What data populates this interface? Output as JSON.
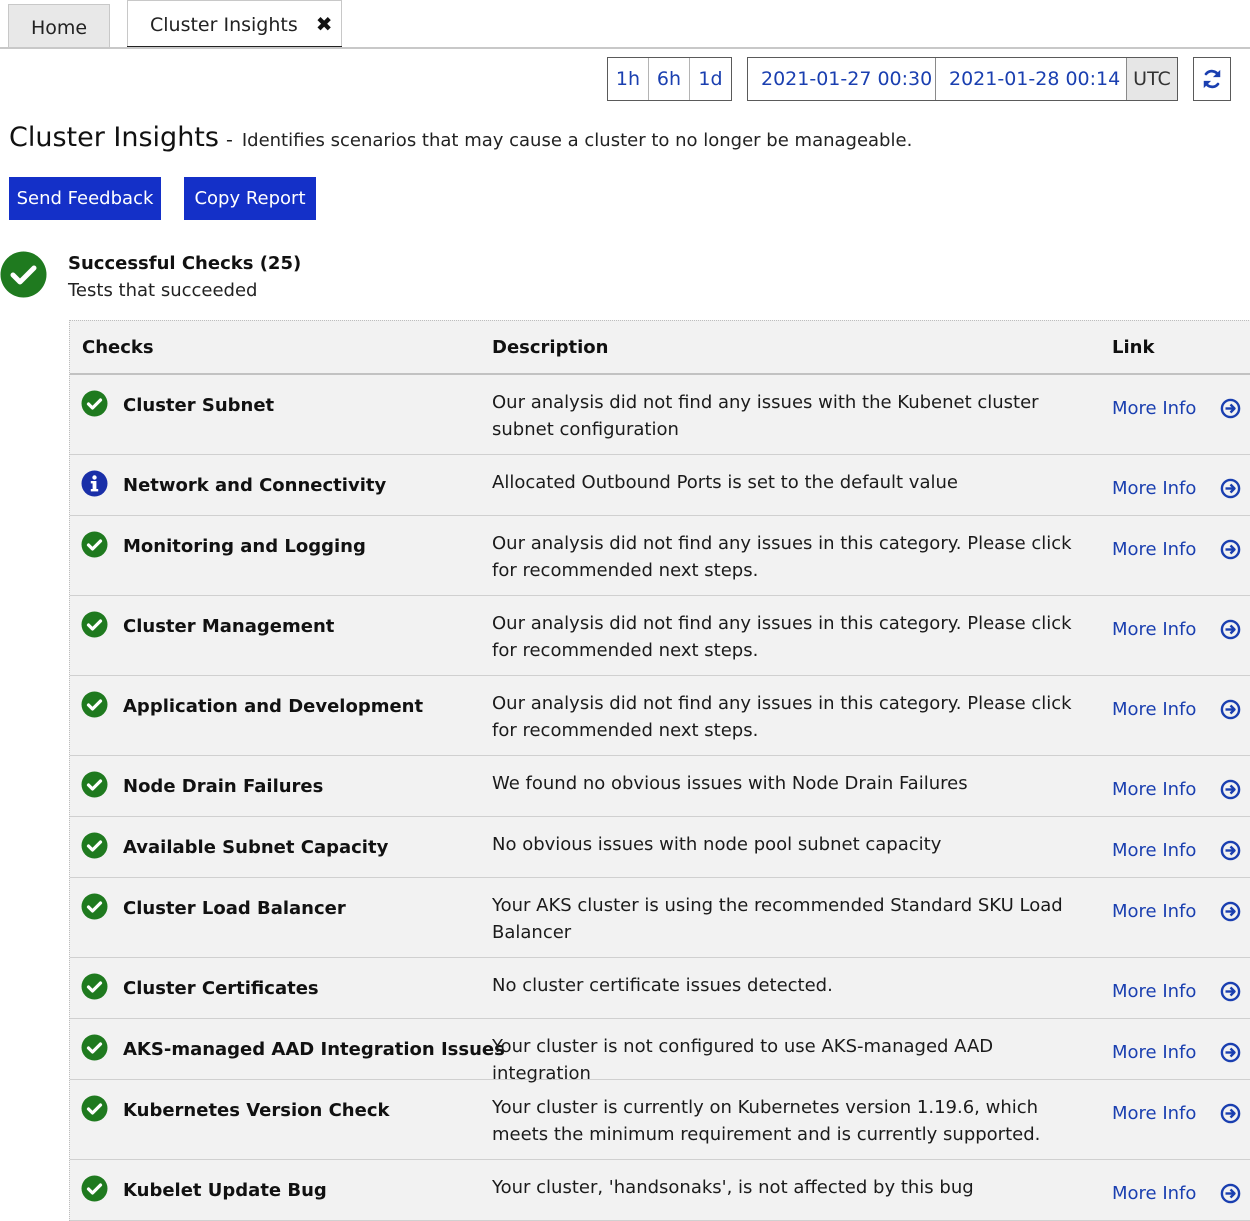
{
  "tabs": {
    "home_label": "Home",
    "active_label": "Cluster Insights",
    "close_glyph": "✖"
  },
  "time_controls": {
    "presets": [
      "1h",
      "6h",
      "1d"
    ],
    "range_start": "2021-01-27 00:30",
    "range_end": "2021-01-28 00:14",
    "timezone": "UTC"
  },
  "header": {
    "title": "Cluster Insights",
    "separator": "-",
    "subtitle": "Identifies scenarios that may cause a cluster to no longer be manageable."
  },
  "actions": {
    "send_feedback": "Send Feedback",
    "copy_report": "Copy Report"
  },
  "summary": {
    "title": "Successful Checks (25)",
    "subtitle": "Tests that succeeded"
  },
  "table": {
    "columns": [
      "Checks",
      "Description",
      "Link"
    ],
    "rows": [
      {
        "status": "success",
        "name": "Cluster Subnet",
        "description": "Our analysis did not find any issues with the Kubenet cluster subnet configuration",
        "link": "More Info"
      },
      {
        "status": "info",
        "name": "Network and Connectivity",
        "description": "Allocated Outbound Ports is set to the default value",
        "link": "More Info"
      },
      {
        "status": "success",
        "name": "Monitoring and Logging",
        "description": "Our analysis did not find any issues in this category. Please click for recommended next steps.",
        "link": "More Info"
      },
      {
        "status": "success",
        "name": "Cluster Management",
        "description": "Our analysis did not find any issues in this category. Please click for recommended next steps.",
        "link": "More Info"
      },
      {
        "status": "success",
        "name": "Application and Development",
        "description": "Our analysis did not find any issues in this category. Please click for recommended next steps.",
        "link": "More Info"
      },
      {
        "status": "success",
        "name": "Node Drain Failures",
        "description": "We found no obvious issues with Node Drain Failures",
        "link": "More Info"
      },
      {
        "status": "success",
        "name": "Available Subnet Capacity",
        "description": "No obvious issues with node pool subnet capacity",
        "link": "More Info"
      },
      {
        "status": "success",
        "name": "Cluster Load Balancer",
        "description": "Your AKS cluster is using the recommended Standard SKU Load Balancer",
        "link": "More Info"
      },
      {
        "status": "success",
        "name": "Cluster Certificates",
        "description": "No cluster certificate issues detected.",
        "link": "More Info"
      },
      {
        "status": "success",
        "name": "AKS-managed AAD Integration Issues",
        "description": "Your cluster is not configured to use AKS-managed AAD integration",
        "link": "More Info"
      },
      {
        "status": "success",
        "name": "Kubernetes Version Check",
        "description": "Your cluster is currently on Kubernetes version 1.19.6, which meets the minimum requirement and is currently supported.",
        "link": "More Info"
      },
      {
        "status": "success",
        "name": "Kubelet Update Bug",
        "description": "Your cluster, 'handsonaks', is not affected by this bug",
        "link": "More Info"
      }
    ]
  },
  "colors": {
    "success": "#1f7a1f",
    "info": "#1a2fa8",
    "link": "#1a3fb0",
    "primary_button": "#1430c8"
  },
  "icons": {
    "success": "check-circle-icon",
    "info": "info-circle-icon",
    "link": "arrow-circle-right-icon",
    "refresh": "refresh-icon"
  }
}
